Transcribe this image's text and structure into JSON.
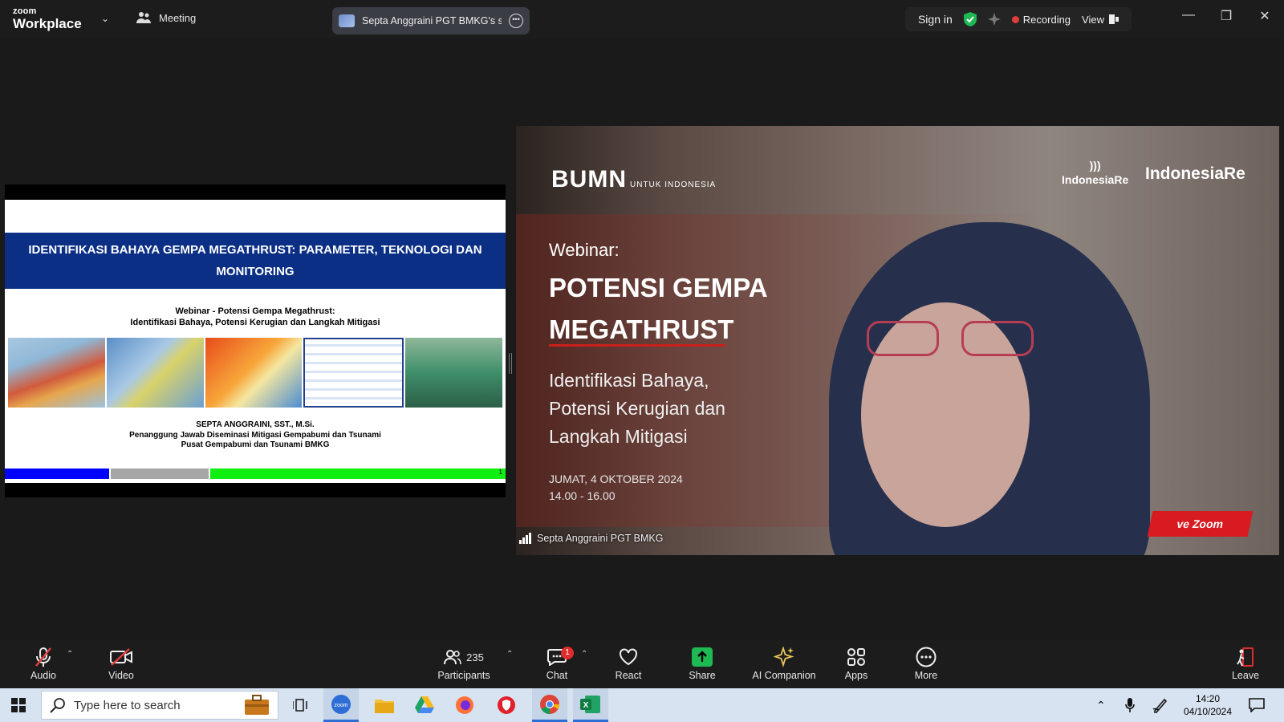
{
  "topbar": {
    "brand_line1": "zoom",
    "brand_line2": "Workplace",
    "meeting_label": "Meeting",
    "share_title": "Septa Anggraini PGT BMKG's scr",
    "signin": "Sign in",
    "recording": "Recording",
    "view": "View"
  },
  "slide": {
    "title_line1": "IDENTIFIKASI BAHAYA GEMPA MEGATHRUST: PARAMETER, TEKNOLOGI DAN",
    "title_line2": "MONITORING",
    "sub_line1": "Webinar -  Potensi Gempa Megathrust:",
    "sub_line2": "Identifikasi Bahaya, Potensi Kerugian dan Langkah Mitigasi",
    "author_name": "SEPTA ANGGRAINI, SST., M.Si.",
    "author_role": "Penanggung Jawab Diseminasi Mitigasi Gempabumi dan Tsunami",
    "author_org": "Pusat Gempabumi dan Tsunami BMKG",
    "page_number": "1"
  },
  "video": {
    "logo_bumn": "BUMN",
    "logo_bumn_small": "UNTUK INDONESIA",
    "logo_ire1": "IndonesiaRe",
    "logo_ire2": "IndonesiaRe",
    "webinar_label": "Webinar:",
    "title_line1": "POTENSI GEMPA",
    "title_line2": "MEGATHRUST",
    "sub_line1": "Identifikasi Bahaya,",
    "sub_line2": "Potensi Kerugian dan",
    "sub_line3": "Langkah Mitigasi",
    "date": "JUMAT, 4 OKTOBER 2024",
    "time": "14.00 - 16.00",
    "badge": "ve Zoom",
    "participant_name": "Septa Anggraini PGT BMKG"
  },
  "toolbar": {
    "audio": "Audio",
    "video": "Video",
    "participants": "Participants",
    "participant_count": "235",
    "chat": "Chat",
    "chat_badge": "1",
    "react": "React",
    "share": "Share",
    "ai_companion": "AI Companion",
    "apps": "Apps",
    "more": "More",
    "leave": "Leave"
  },
  "taskbar": {
    "search_placeholder": "Type here to search",
    "time": "14:20",
    "date": "04/10/2024"
  },
  "colors": {
    "slide_header": "#0b2f85",
    "recording_dot": "#e23d3d",
    "share_green": "#1fb954",
    "leave_red": "#e02c2c"
  }
}
